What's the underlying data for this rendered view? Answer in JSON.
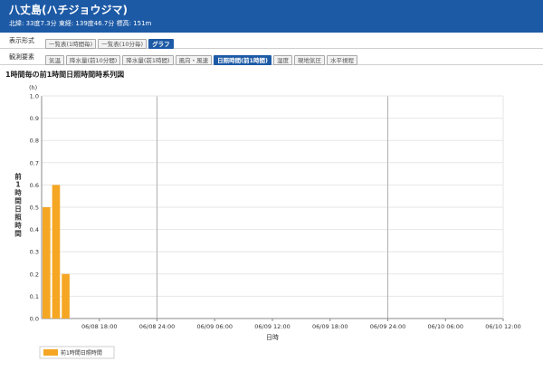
{
  "header": {
    "title": "八丈島(ハチジョウジマ)",
    "meta": "北緯: 33度7.3分 東経: 139度46.7分 標高: 151m"
  },
  "display_format": {
    "label": "表示形式",
    "buttons": [
      {
        "label": "一覧表(1時間毎)",
        "active": false
      },
      {
        "label": "一覧表(10分毎)",
        "active": false
      },
      {
        "label": "グラフ",
        "active": true
      }
    ]
  },
  "elements": {
    "label": "観測要素",
    "buttons": [
      {
        "label": "気温",
        "active": false
      },
      {
        "label": "降水量(前10分間)",
        "active": false
      },
      {
        "label": "降水量(前1時間)",
        "active": false
      },
      {
        "label": "風向・風速",
        "active": false
      },
      {
        "label": "日照時間(前1時間)",
        "active": true
      },
      {
        "label": "湿度",
        "active": false
      },
      {
        "label": "現地気圧",
        "active": false
      },
      {
        "label": "水平視程",
        "active": false
      }
    ]
  },
  "chart_title": "1時間毎の前1時間日照時間時系列図",
  "colors": {
    "accent": "#1d5aa6",
    "bar": "#f5a623",
    "grid": "#e6e6e6",
    "axis": "#888888"
  },
  "chart_data": {
    "type": "bar",
    "unit": "(h)",
    "ylabel": "前1時間日照時間",
    "xlabel": "日時",
    "ylim": [
      0,
      1.0
    ],
    "yticks": [
      "0.0",
      "0.1",
      "0.2",
      "0.3",
      "0.4",
      "0.5",
      "0.6",
      "0.7",
      "0.8",
      "0.9",
      "1.0"
    ],
    "xlim_hours": [
      0,
      48
    ],
    "x_ticks": [
      {
        "label": "06/08 18:00",
        "hour": 6
      },
      {
        "label": "06/08 24:00",
        "hour": 12
      },
      {
        "label": "06/09 06:00",
        "hour": 18
      },
      {
        "label": "06/09 12:00",
        "hour": 24
      },
      {
        "label": "06/09 18:00",
        "hour": 30
      },
      {
        "label": "06/09 24:00",
        "hour": 36
      },
      {
        "label": "06/10 06:00",
        "hour": 42
      },
      {
        "label": "06/10 12:00",
        "hour": 48
      }
    ],
    "day_boundaries_hours": [
      12,
      36
    ],
    "bars": [
      {
        "hour": 1,
        "value": 0.5
      },
      {
        "hour": 2,
        "value": 0.6
      },
      {
        "hour": 3,
        "value": 0.2
      }
    ],
    "legend": {
      "label": "前1時間日照時間",
      "position": "bottom-left"
    }
  }
}
